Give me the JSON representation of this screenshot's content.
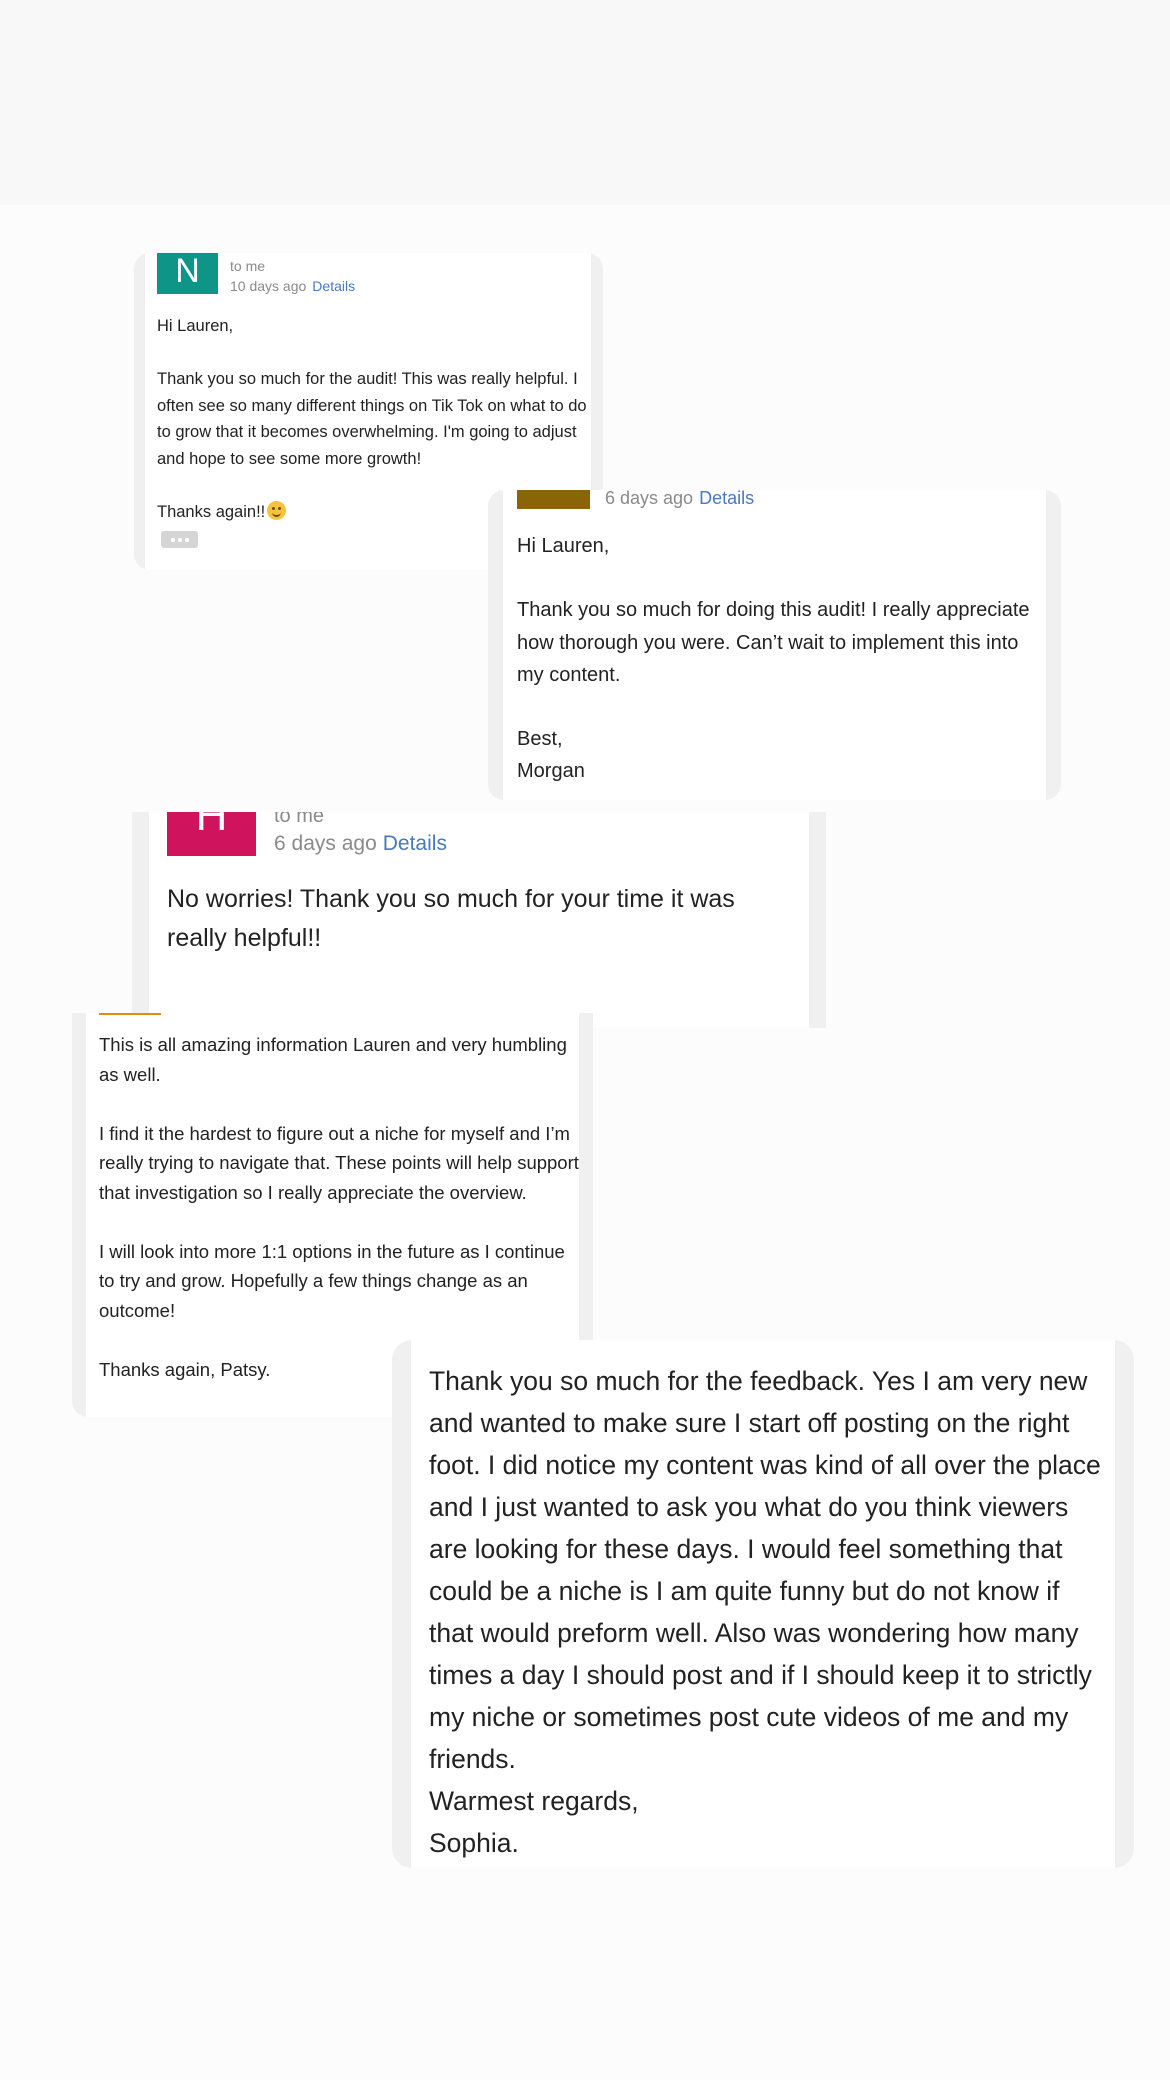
{
  "emails": [
    {
      "avatar_letter": "N",
      "avatar_color": "#0f9488",
      "recipient": "to me",
      "time": "10 days ago",
      "details_label": "Details",
      "body": "Hi Lauren,\n\nThank you so much for the audit! This was really helpful. I often see so many different things on Tik Tok on what to do to grow that it becomes overwhelming. I'm going to adjust and hope to see some more growth!\n\nThanks again!!",
      "emoji": "smiling-face-emoji",
      "more_icon": "ellipsis-icon"
    },
    {
      "avatar_color": "#8a6508",
      "time": "6 days ago",
      "details_label": "Details",
      "body": "Hi Lauren,\n\nThank you so much for doing this audit! I really appreciate how thorough you were. Can’t wait to implement this into my content.\n\nBest,\nMorgan"
    },
    {
      "avatar_letter": "H",
      "avatar_color": "#d0135d",
      "recipient": "to me",
      "time": "6 days ago",
      "details_label": "Details",
      "body": "No worries! Thank you so much for your time it was really helpful!!"
    },
    {
      "accent_color": "#e08a18",
      "body": "This is all amazing information Lauren and very humbling as well.\n\nI find it the hardest to figure out a niche for myself and I’m really trying to navigate that. These points will help support that investigation so I really appreciate the overview.\n\nI will look into more 1:1 options in the future as I continue to try and grow. Hopefully a few things change as an outcome!\n\nThanks again, Patsy."
    },
    {
      "body": "Thank you so much for the feedback. Yes I am very new and wanted to make sure I start off posting on the right foot. I did notice my content was kind of all over the place and I just wanted to ask you what do you think viewers are looking for these days. I would feel something that could be a niche is I am quite funny but do not know if that would preform well. Also was wondering how many times a day I should post and if I should keep it to strictly my niche or sometimes post cute videos of me and my friends.\nWarmest regards,\nSophia."
    }
  ]
}
